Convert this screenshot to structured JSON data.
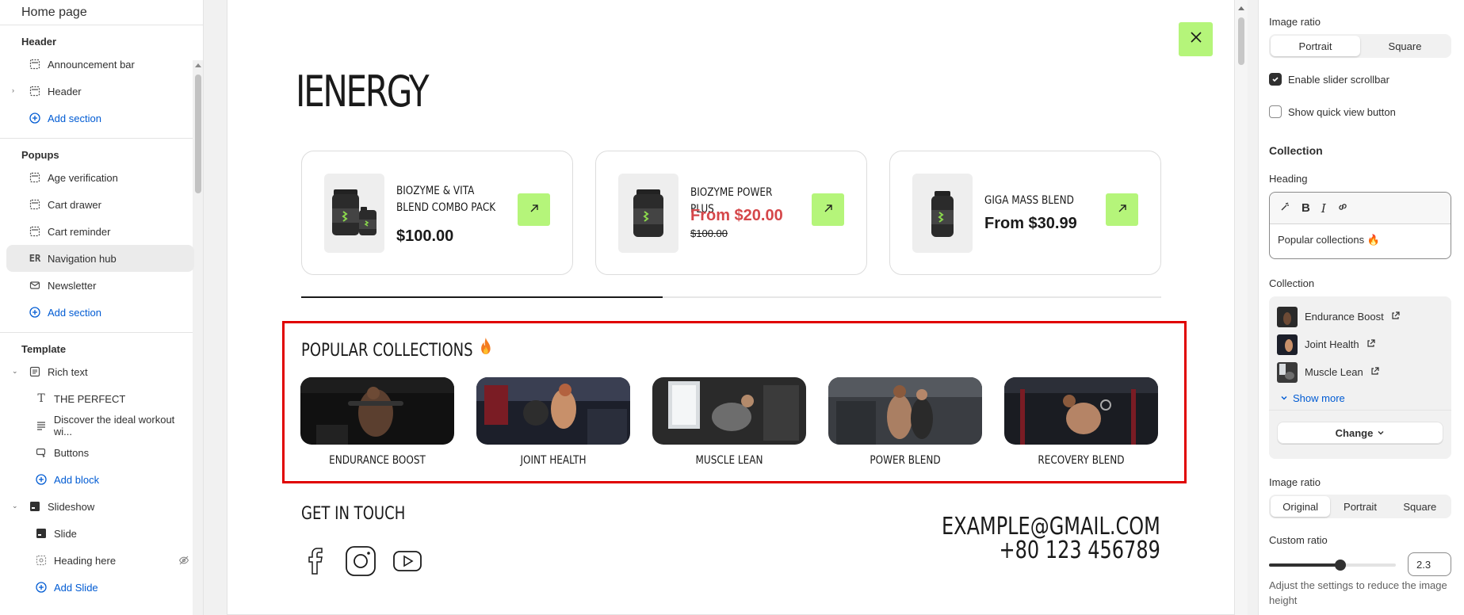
{
  "sidebar": {
    "title": "Home page",
    "header_group": {
      "label": "Header",
      "items": [
        {
          "label": "Announcement bar",
          "icon": "section-icon"
        },
        {
          "label": "Header",
          "icon": "section-icon"
        }
      ],
      "add_label": "Add section"
    },
    "popups_group": {
      "label": "Popups",
      "items": [
        {
          "label": "Age verification",
          "icon": "section-icon"
        },
        {
          "label": "Cart drawer",
          "icon": "section-icon"
        },
        {
          "label": "Cart reminder",
          "icon": "section-icon"
        },
        {
          "label": "Navigation hub",
          "icon": "app-block-icon",
          "badge": "ER"
        },
        {
          "label": "Newsletter",
          "icon": "email-icon"
        }
      ],
      "add_label": "Add section"
    },
    "template_group": {
      "label": "Template",
      "rich_text": "Rich text",
      "rich_text_children": [
        {
          "label": "THE PERFECT",
          "icon": "text-icon"
        },
        {
          "label": "Discover the ideal workout wi...",
          "icon": "paragraph-icon"
        },
        {
          "label": "Buttons",
          "icon": "button-icon"
        }
      ],
      "add_block": "Add block",
      "slideshow": "Slideshow",
      "slideshow_children": [
        {
          "label": "Slide",
          "icon": "image-icon"
        },
        {
          "label": "Heading here",
          "icon": "heading-icon"
        }
      ],
      "add_slide": "Add Slide"
    }
  },
  "preview": {
    "brand": "IENERGY",
    "products": [
      {
        "name": "BIOZYME & VITA BLEND COMBO PACK",
        "price": "$100.00",
        "old_price": "",
        "sale": false
      },
      {
        "name": "BIOZYME POWER PLUS",
        "price": "From $20.00",
        "old_price": "$100.00",
        "sale": true
      },
      {
        "name": "GIGA MASS BLEND",
        "price": "From $30.99",
        "old_price": "",
        "sale": false
      }
    ],
    "progress_fraction": 0.42,
    "collections_heading": "POPULAR COLLECTIONS",
    "collections": [
      {
        "label": "ENDURANCE BOOST"
      },
      {
        "label": "JOINT HEALTH"
      },
      {
        "label": "MUSCLE LEAN"
      },
      {
        "label": "POWER BLEND"
      },
      {
        "label": "RECOVERY BLEND"
      }
    ],
    "get_in_touch": "GET IN TOUCH",
    "email": "EXAMPLE@GMAIL.COM",
    "phone": "+80 123 456789",
    "accent_color": "#b5f57a",
    "sale_color": "#d5474a",
    "highlight_color": "#e00000"
  },
  "settings": {
    "image_ratio_label": "Image ratio",
    "image_ratio_options": [
      "Portrait",
      "Square"
    ],
    "image_ratio_selected": "Portrait",
    "enable_slider_scrollbar": {
      "label": "Enable slider scrollbar",
      "checked": true
    },
    "show_quick_view": {
      "label": "Show quick view button",
      "checked": false
    },
    "collection_title": "Collection",
    "heading_label": "Heading",
    "heading_value": "Popular collections 🔥",
    "collection_label": "Collection",
    "collection_items": [
      "Endurance Boost",
      "Joint Health",
      "Muscle Lean"
    ],
    "show_more": "Show more",
    "change_button": "Change",
    "image_ratio2_label": "Image ratio",
    "image_ratio2_options": [
      "Original",
      "Portrait",
      "Square"
    ],
    "image_ratio2_selected": "Original",
    "custom_ratio_label": "Custom ratio",
    "custom_ratio_value": "2.3",
    "custom_ratio_fraction": 0.56,
    "custom_ratio_help": "Adjust the settings to reduce the image height"
  }
}
